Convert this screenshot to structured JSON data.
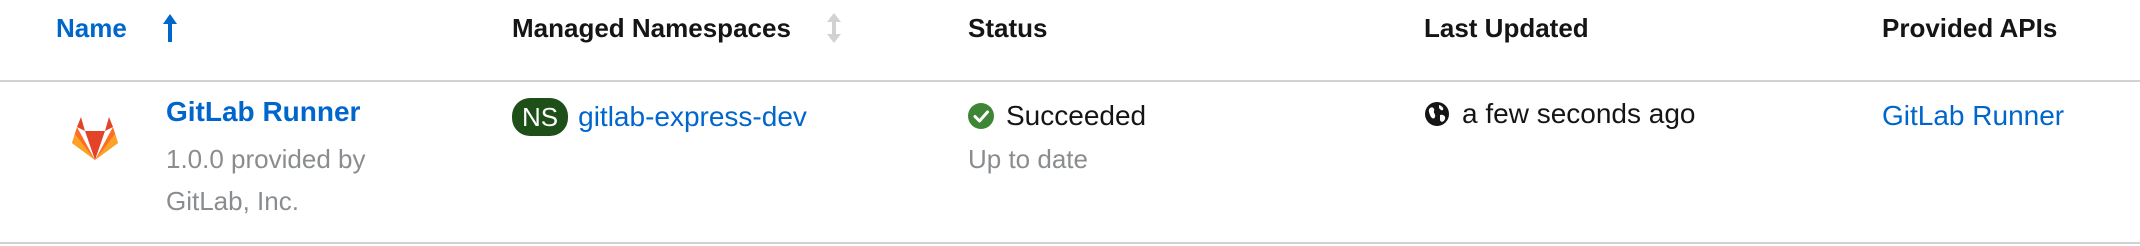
{
  "table": {
    "columns": {
      "name": "Name",
      "managed_namespaces": "Managed Namespaces",
      "status": "Status",
      "last_updated": "Last Updated",
      "provided_apis": "Provided APIs"
    },
    "sort": {
      "name_icon": "arrow-up-icon",
      "namespaces_icon": "sort-both-icon"
    },
    "rows": [
      {
        "logo_icon": "gitlab-logo-icon",
        "name": "GitLab Runner",
        "provider": "1.0.0 provided by GitLab, Inc.",
        "namespace_badge": "NS",
        "namespace": "gitlab-express-dev",
        "status_icon": "check-circle-icon",
        "status": "Succeeded",
        "status_detail": "Up to date",
        "updated_icon": "globe-icon",
        "last_updated": "a few seconds ago",
        "provided_api": "GitLab Runner"
      }
    ]
  },
  "colors": {
    "link": "#0066cc",
    "success": "#3e8635",
    "namespace_badge": "#1e4f18",
    "muted_text": "#8a8d90",
    "divider": "#d2d2d2"
  }
}
